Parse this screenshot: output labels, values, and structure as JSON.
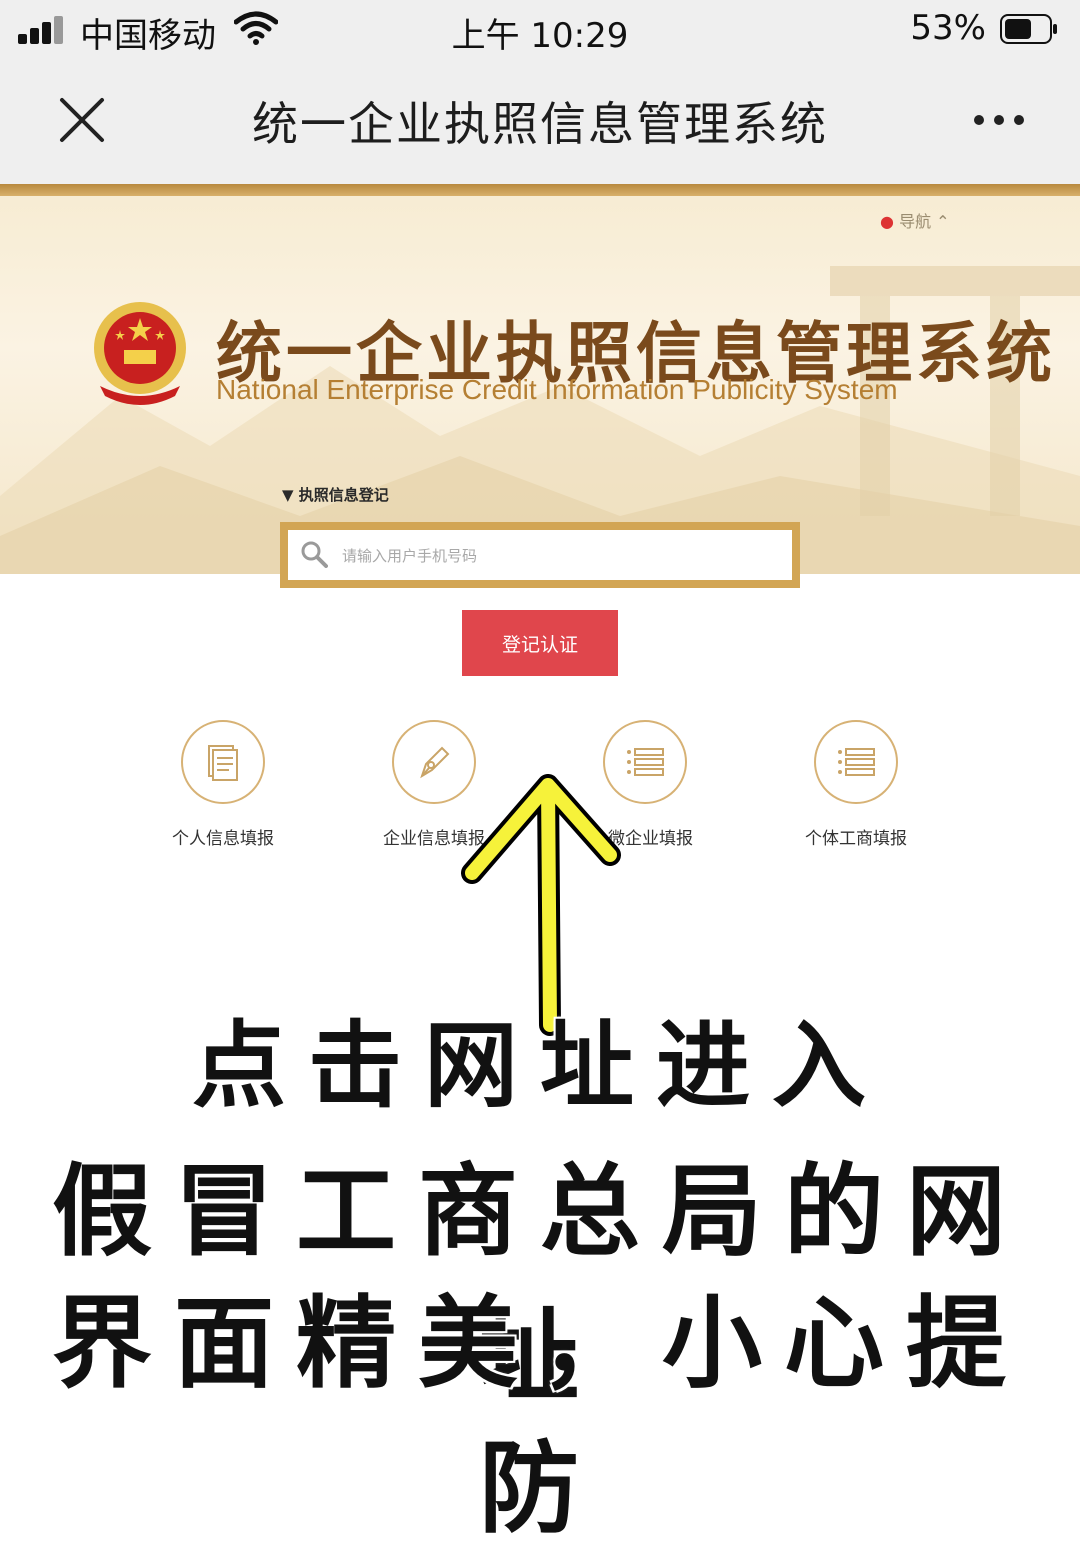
{
  "status_bar": {
    "carrier": "中国移动",
    "time": "上午 10:29",
    "battery": "53%"
  },
  "nav_bar": {
    "title": "统一企业执照信息管理系统",
    "close_icon": "close-icon",
    "more_icon": "more-icon"
  },
  "hero": {
    "nav_link": "导航",
    "title": "统一企业执照信息管理系统",
    "subtitle": "National Enterprise Credit Information Publicity System",
    "search_label": "执照信息登记",
    "search_placeholder": "请输入用户手机号码"
  },
  "login_button": "登记认证",
  "shortcuts": [
    {
      "label": "个人信息填报",
      "icon": "document-icon"
    },
    {
      "label": "企业信息填报",
      "icon": "pen-icon"
    },
    {
      "label": "/ 微企业填报",
      "icon": "list-icon"
    },
    {
      "label": "个体工商填报",
      "icon": "list-icon"
    }
  ],
  "caption": {
    "line1": "点击网址进入",
    "line2": "假冒工商总局的网址",
    "line3": "界面精美，小心提防"
  },
  "colors": {
    "gold": "#d2a554",
    "red_button": "#e0464c",
    "arrow_fill": "#f6f23a"
  }
}
